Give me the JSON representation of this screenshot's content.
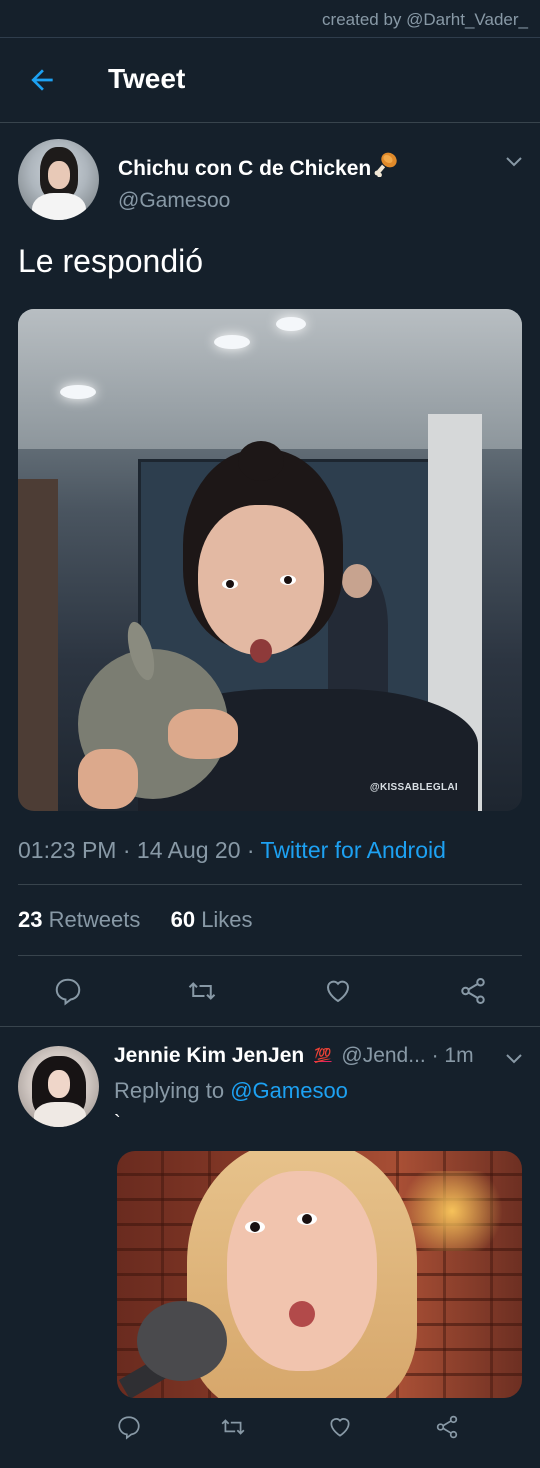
{
  "watermark": "created by @Darht_Vader_",
  "header": {
    "title": "Tweet",
    "back_icon": "arrow-left-icon"
  },
  "tweet": {
    "author_name": "Chichu con C de Chicken",
    "author_emoji": "drumstick-icon",
    "author_handle": "@Gamesoo",
    "text": "Le respondió",
    "media_watermark": "@KISSABLEGLAI",
    "time": "01:23 PM",
    "date": "14 Aug 20",
    "source": "Twitter for Android",
    "retweets_count": "23",
    "retweets_label": "Retweets",
    "likes_count": "60",
    "likes_label": "Likes",
    "actions": [
      "reply-icon",
      "retweet-icon",
      "like-icon",
      "share-icon"
    ]
  },
  "reply": {
    "author_name": "Jennie Kim JenJen",
    "emoji": "💯",
    "handle": "@Jend...",
    "time": "1m",
    "replying_prefix": "Replying to",
    "replying_to": "@Gamesoo",
    "text": "`",
    "actions": [
      "reply-icon",
      "retweet-icon",
      "like-icon",
      "share-icon"
    ]
  },
  "colors": {
    "background": "#15202b",
    "accent": "#1da1f2",
    "secondary_text": "#8899a6",
    "divider": "#38444d"
  }
}
